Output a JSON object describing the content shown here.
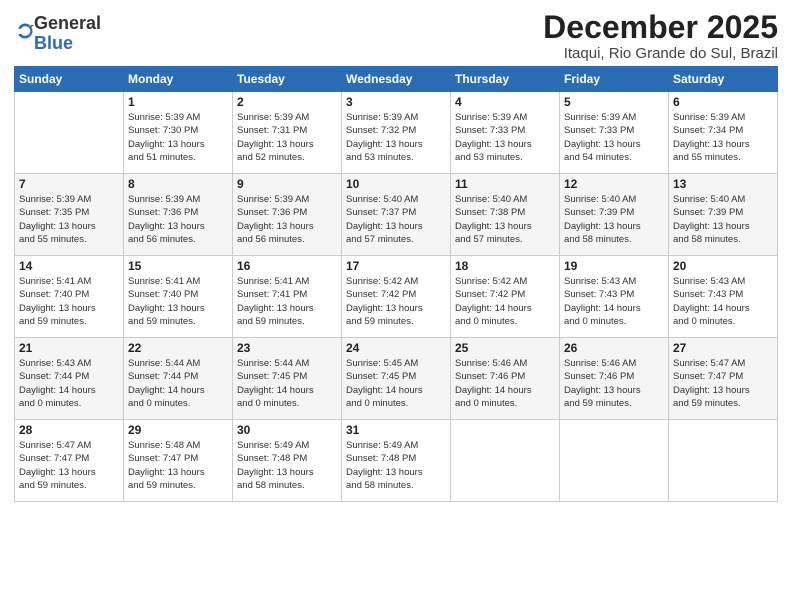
{
  "logo": {
    "general": "General",
    "blue": "Blue"
  },
  "title": "December 2025",
  "location": "Itaqui, Rio Grande do Sul, Brazil",
  "days_of_week": [
    "Sunday",
    "Monday",
    "Tuesday",
    "Wednesday",
    "Thursday",
    "Friday",
    "Saturday"
  ],
  "weeks": [
    [
      {
        "day": "",
        "info": ""
      },
      {
        "day": "1",
        "info": "Sunrise: 5:39 AM\nSunset: 7:30 PM\nDaylight: 13 hours\nand 51 minutes."
      },
      {
        "day": "2",
        "info": "Sunrise: 5:39 AM\nSunset: 7:31 PM\nDaylight: 13 hours\nand 52 minutes."
      },
      {
        "day": "3",
        "info": "Sunrise: 5:39 AM\nSunset: 7:32 PM\nDaylight: 13 hours\nand 53 minutes."
      },
      {
        "day": "4",
        "info": "Sunrise: 5:39 AM\nSunset: 7:33 PM\nDaylight: 13 hours\nand 53 minutes."
      },
      {
        "day": "5",
        "info": "Sunrise: 5:39 AM\nSunset: 7:33 PM\nDaylight: 13 hours\nand 54 minutes."
      },
      {
        "day": "6",
        "info": "Sunrise: 5:39 AM\nSunset: 7:34 PM\nDaylight: 13 hours\nand 55 minutes."
      }
    ],
    [
      {
        "day": "7",
        "info": "Sunrise: 5:39 AM\nSunset: 7:35 PM\nDaylight: 13 hours\nand 55 minutes."
      },
      {
        "day": "8",
        "info": "Sunrise: 5:39 AM\nSunset: 7:36 PM\nDaylight: 13 hours\nand 56 minutes."
      },
      {
        "day": "9",
        "info": "Sunrise: 5:39 AM\nSunset: 7:36 PM\nDaylight: 13 hours\nand 56 minutes."
      },
      {
        "day": "10",
        "info": "Sunrise: 5:40 AM\nSunset: 7:37 PM\nDaylight: 13 hours\nand 57 minutes."
      },
      {
        "day": "11",
        "info": "Sunrise: 5:40 AM\nSunset: 7:38 PM\nDaylight: 13 hours\nand 57 minutes."
      },
      {
        "day": "12",
        "info": "Sunrise: 5:40 AM\nSunset: 7:39 PM\nDaylight: 13 hours\nand 58 minutes."
      },
      {
        "day": "13",
        "info": "Sunrise: 5:40 AM\nSunset: 7:39 PM\nDaylight: 13 hours\nand 58 minutes."
      }
    ],
    [
      {
        "day": "14",
        "info": "Sunrise: 5:41 AM\nSunset: 7:40 PM\nDaylight: 13 hours\nand 59 minutes."
      },
      {
        "day": "15",
        "info": "Sunrise: 5:41 AM\nSunset: 7:40 PM\nDaylight: 13 hours\nand 59 minutes."
      },
      {
        "day": "16",
        "info": "Sunrise: 5:41 AM\nSunset: 7:41 PM\nDaylight: 13 hours\nand 59 minutes."
      },
      {
        "day": "17",
        "info": "Sunrise: 5:42 AM\nSunset: 7:42 PM\nDaylight: 13 hours\nand 59 minutes."
      },
      {
        "day": "18",
        "info": "Sunrise: 5:42 AM\nSunset: 7:42 PM\nDaylight: 14 hours\nand 0 minutes."
      },
      {
        "day": "19",
        "info": "Sunrise: 5:43 AM\nSunset: 7:43 PM\nDaylight: 14 hours\nand 0 minutes."
      },
      {
        "day": "20",
        "info": "Sunrise: 5:43 AM\nSunset: 7:43 PM\nDaylight: 14 hours\nand 0 minutes."
      }
    ],
    [
      {
        "day": "21",
        "info": "Sunrise: 5:43 AM\nSunset: 7:44 PM\nDaylight: 14 hours\nand 0 minutes."
      },
      {
        "day": "22",
        "info": "Sunrise: 5:44 AM\nSunset: 7:44 PM\nDaylight: 14 hours\nand 0 minutes."
      },
      {
        "day": "23",
        "info": "Sunrise: 5:44 AM\nSunset: 7:45 PM\nDaylight: 14 hours\nand 0 minutes."
      },
      {
        "day": "24",
        "info": "Sunrise: 5:45 AM\nSunset: 7:45 PM\nDaylight: 14 hours\nand 0 minutes."
      },
      {
        "day": "25",
        "info": "Sunrise: 5:46 AM\nSunset: 7:46 PM\nDaylight: 14 hours\nand 0 minutes."
      },
      {
        "day": "26",
        "info": "Sunrise: 5:46 AM\nSunset: 7:46 PM\nDaylight: 13 hours\nand 59 minutes."
      },
      {
        "day": "27",
        "info": "Sunrise: 5:47 AM\nSunset: 7:47 PM\nDaylight: 13 hours\nand 59 minutes."
      }
    ],
    [
      {
        "day": "28",
        "info": "Sunrise: 5:47 AM\nSunset: 7:47 PM\nDaylight: 13 hours\nand 59 minutes."
      },
      {
        "day": "29",
        "info": "Sunrise: 5:48 AM\nSunset: 7:47 PM\nDaylight: 13 hours\nand 59 minutes."
      },
      {
        "day": "30",
        "info": "Sunrise: 5:49 AM\nSunset: 7:48 PM\nDaylight: 13 hours\nand 58 minutes."
      },
      {
        "day": "31",
        "info": "Sunrise: 5:49 AM\nSunset: 7:48 PM\nDaylight: 13 hours\nand 58 minutes."
      },
      {
        "day": "",
        "info": ""
      },
      {
        "day": "",
        "info": ""
      },
      {
        "day": "",
        "info": ""
      }
    ]
  ]
}
